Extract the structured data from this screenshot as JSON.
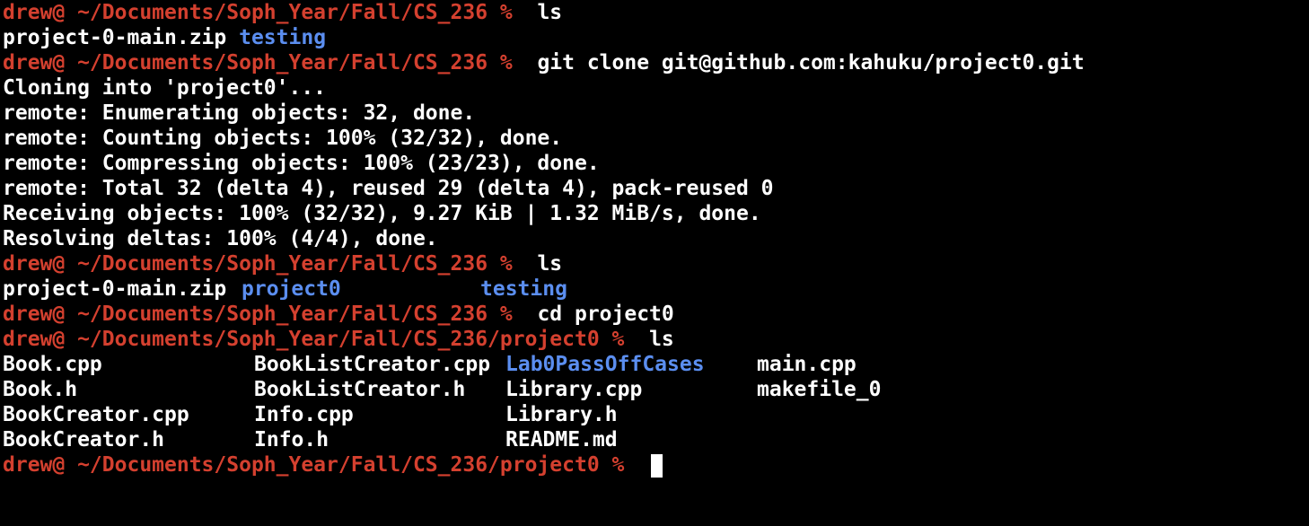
{
  "colors": {
    "background": "#000000",
    "prompt": "#d4402f",
    "text": "#ffffff",
    "directory": "#5b8ef0"
  },
  "lines": [
    {
      "prompt": "drew@ ~/Documents/Soph_Year/Fall/CS_236 %",
      "command": "ls"
    },
    {
      "files": [
        "project-0-main.zip"
      ],
      "dirs": [
        "testing"
      ]
    },
    {
      "prompt": "drew@ ~/Documents/Soph_Year/Fall/CS_236 %",
      "command": "git clone git@github.com:kahuku/project0.git"
    },
    {
      "output": "Cloning into 'project0'..."
    },
    {
      "output": "remote: Enumerating objects: 32, done."
    },
    {
      "output": "remote: Counting objects: 100% (32/32), done."
    },
    {
      "output": "remote: Compressing objects: 100% (23/23), done."
    },
    {
      "output": "remote: Total 32 (delta 4), reused 29 (delta 4), pack-reused 0"
    },
    {
      "output": "Receiving objects: 100% (32/32), 9.27 KiB | 1.32 MiB/s, done."
    },
    {
      "output": "Resolving deltas: 100% (4/4), done."
    },
    {
      "prompt": "drew@ ~/Documents/Soph_Year/Fall/CS_236 %",
      "command": "ls"
    },
    {
      "ls2": [
        "project-0-main.zip",
        "project0",
        "testing"
      ]
    },
    {
      "prompt": "drew@ ~/Documents/Soph_Year/Fall/CS_236 %",
      "command": "cd project0"
    },
    {
      "prompt": "drew@ ~/Documents/Soph_Year/Fall/CS_236/project0 %",
      "command": "ls"
    }
  ],
  "listing": {
    "rows": [
      [
        "Book.cpp",
        "BookListCreator.cpp",
        "Lab0PassOffCases",
        "main.cpp"
      ],
      [
        "Book.h",
        "BookListCreator.h",
        "Library.cpp",
        "makefile_0"
      ],
      [
        "BookCreator.cpp",
        "Info.cpp",
        "Library.h",
        ""
      ],
      [
        "BookCreator.h",
        "Info.h",
        "README.md",
        ""
      ]
    ],
    "dir_name": "Lab0PassOffCases"
  },
  "final_prompt": "drew@ ~/Documents/Soph_Year/Fall/CS_236/project0 %"
}
